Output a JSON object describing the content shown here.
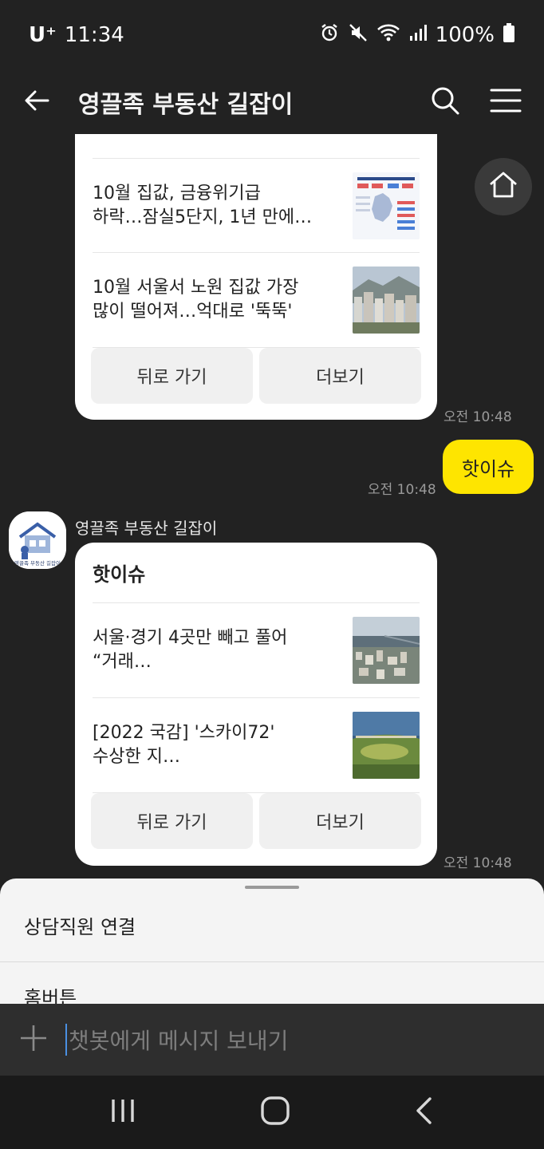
{
  "status": {
    "carrier": "U⁺",
    "time": "11:34",
    "battery": "100%"
  },
  "header": {
    "title": "영끌족 부동산 길잡이"
  },
  "card1": {
    "items": [
      {
        "line1": "10월 집값, 금융위기급",
        "line2": "하락…잠실5단지, 1년 만에…"
      },
      {
        "line1": "10월 서울서 노원 집값 가장",
        "line2": "많이 떨어져…억대로 '뚝뚝'"
      }
    ],
    "back_label": "뒤로 가기",
    "more_label": "더보기",
    "time": "오전 10:48"
  },
  "user_message": {
    "text": "핫이슈",
    "time": "오전 10:48"
  },
  "bot": {
    "sender": "영끌족 부동산 길잡이",
    "avatar_caption": "영끌족 부동산 길잡이"
  },
  "card2": {
    "title": "핫이슈",
    "items": [
      {
        "line1": "서울·경기 4곳만 빼고 풀어",
        "line2": "“거래…"
      },
      {
        "line1": "[2022 국감] '스카이72'",
        "line2": "수상한 지…"
      }
    ],
    "back_label": "뒤로 가기",
    "more_label": "더보기",
    "time": "오전 10:48"
  },
  "sheet": {
    "items": [
      "상담직원 연결",
      "홈버튼"
    ]
  },
  "input": {
    "placeholder": "챗봇에게 메시지 보내기"
  },
  "colors": {
    "background": "#222222",
    "user_bubble": "#fee500",
    "card": "#ffffff"
  }
}
